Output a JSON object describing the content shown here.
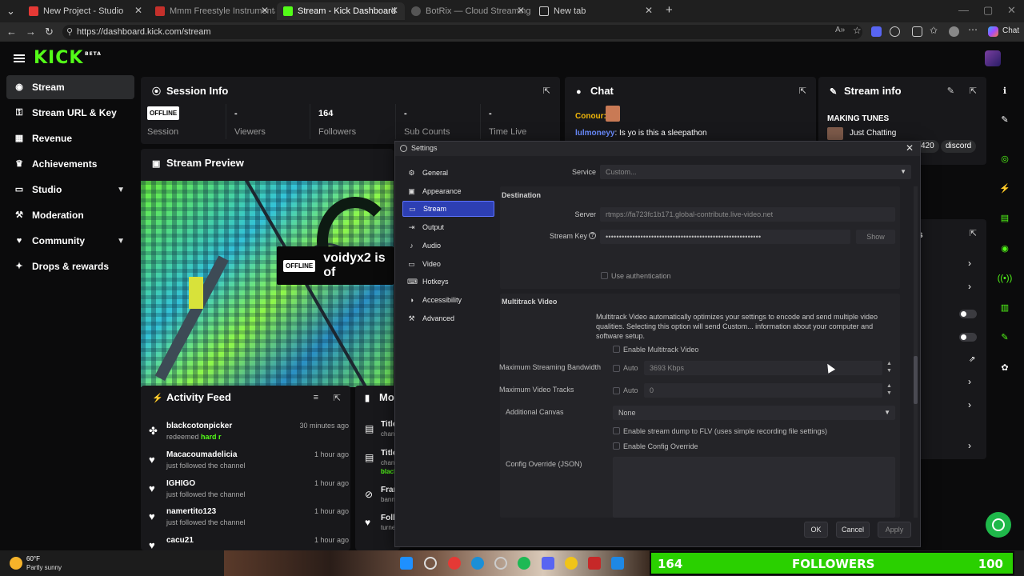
{
  "browser": {
    "tabs": [
      {
        "title": "New Project - Studio"
      },
      {
        "title": "Mmm Freestyle Instrumental #FR"
      },
      {
        "title": "Stream - Kick Dashboard"
      },
      {
        "title": "BotRix — Cloud Streaming Bot fo"
      },
      {
        "title": "New tab"
      }
    ],
    "url": "https://dashboard.kick.com/stream",
    "profile_label": "Chat"
  },
  "kick": {
    "logo": "KICK",
    "logo_sup": "BETA",
    "sidebar": [
      {
        "label": "Stream",
        "icon": "broadcast-icon"
      },
      {
        "label": "Stream URL & Key",
        "icon": "key-icon"
      },
      {
        "label": "Revenue",
        "icon": "revenue-icon"
      },
      {
        "label": "Achievements",
        "icon": "trophy-icon"
      },
      {
        "label": "Studio",
        "icon": "studio-icon"
      },
      {
        "label": "Moderation",
        "icon": "gavel-icon"
      },
      {
        "label": "Community",
        "icon": "community-icon"
      },
      {
        "label": "Drops & rewards",
        "icon": "gift-icon"
      }
    ],
    "session": {
      "title": "Session Info",
      "status_badge": "OFFLINE",
      "cells": [
        {
          "value": "",
          "label": "Session"
        },
        {
          "value": "-",
          "label": "Viewers"
        },
        {
          "value": "164",
          "label": "Followers"
        },
        {
          "value": "-",
          "label": "Sub Counts"
        },
        {
          "value": "-",
          "label": "Time Live"
        }
      ]
    },
    "preview": {
      "title": "Stream Preview",
      "badge": "OFFLINE",
      "text": "voidyx2 is of"
    },
    "chat": {
      "title": "Chat",
      "messages": [
        {
          "user": "Conour:",
          "text": ""
        },
        {
          "user": "lulmoneyy",
          "text": ": Is yo is this a sleepathon"
        }
      ]
    },
    "stream_info": {
      "title": "Stream info",
      "stream_title": "MAKING TUNES",
      "category": "Just Chatting",
      "tags": [
        "420",
        "discord"
      ],
      "partial_label": "s"
    },
    "activity": {
      "title": "Activity Feed",
      "items": [
        {
          "name": "blackcotonpicker",
          "sub": "redeemed",
          "sub_highlight": "hard r",
          "time": "30 minutes ago",
          "icon": "redeem-icon"
        },
        {
          "name": "Macacoumadelicia",
          "sub": "just followed the channel",
          "sub_highlight": "",
          "time": "1 hour ago",
          "icon": "heart-icon"
        },
        {
          "name": "IGHIGO",
          "sub": "just followed the channel",
          "sub_highlight": "",
          "time": "1 hour ago",
          "icon": "heart-icon"
        },
        {
          "name": "namertito123",
          "sub": "just followed the channel",
          "sub_highlight": "",
          "time": "1 hour ago",
          "icon": "heart-icon"
        },
        {
          "name": "cacu21",
          "sub": "",
          "sub_highlight": "",
          "time": "1 hour ago",
          "icon": "heart-icon"
        }
      ]
    },
    "mod_actions": {
      "title": "Mo",
      "items": [
        {
          "title": "Title",
          "sub": "chan"
        },
        {
          "title": "Title",
          "sub": "chan"
        },
        {
          "title": "",
          "sub": "black"
        },
        {
          "title": "Fran",
          "sub": "bann"
        },
        {
          "title": "Follo",
          "sub": "turne"
        }
      ]
    }
  },
  "obs": {
    "title": "Settings",
    "nav": [
      {
        "label": "General",
        "icon": "gear-icon"
      },
      {
        "label": "Appearance",
        "icon": "appearance-icon"
      },
      {
        "label": "Stream",
        "icon": "stream-icon"
      },
      {
        "label": "Output",
        "icon": "output-icon"
      },
      {
        "label": "Audio",
        "icon": "audio-icon"
      },
      {
        "label": "Video",
        "icon": "video-icon"
      },
      {
        "label": "Hotkeys",
        "icon": "keyboard-icon"
      },
      {
        "label": "Accessibility",
        "icon": "accessibility-icon"
      },
      {
        "label": "Advanced",
        "icon": "wrench-icon"
      }
    ],
    "service_label": "Service",
    "service_value": "Custom...",
    "destination_title": "Destination",
    "server_label": "Server",
    "server_value": "rtmps://fa723fc1b171.global-contribute.live-video.net",
    "key_label": "Stream Key",
    "key_value": "••••••••••••••••••••••••••••••••••••••••••••••••••••••••••",
    "show_label": "Show",
    "use_auth_label": "Use authentication",
    "multitrack_title": "Multitrack Video",
    "multitrack_desc": "Multitrack Video automatically optimizes your settings to encode and send multiple video qualities. Selecting this option will send Custom... information about your computer and software setup.",
    "enable_multitrack_label": "Enable Multitrack Video",
    "max_bandwidth_label": "Maximum Streaming Bandwidth",
    "auto_label": "Auto",
    "max_bandwidth_value": "3693 Kbps",
    "max_tracks_label": "Maximum Video Tracks",
    "max_tracks_value": "0",
    "additional_canvas_label": "Additional Canvas",
    "additional_canvas_value": "None",
    "dump_flv_label": "Enable stream dump to FLV (uses simple recording file settings)",
    "config_override_check_label": "Enable Config Override",
    "config_override_label": "Config Override (JSON)",
    "ok_label": "OK",
    "cancel_label": "Cancel",
    "apply_label": "Apply"
  },
  "taskbar": {
    "weather_temp": "60°F",
    "weather_desc": "Partly sunny",
    "follower_count": "164",
    "followers_label": "FOLLOWERS",
    "goal": "100"
  }
}
